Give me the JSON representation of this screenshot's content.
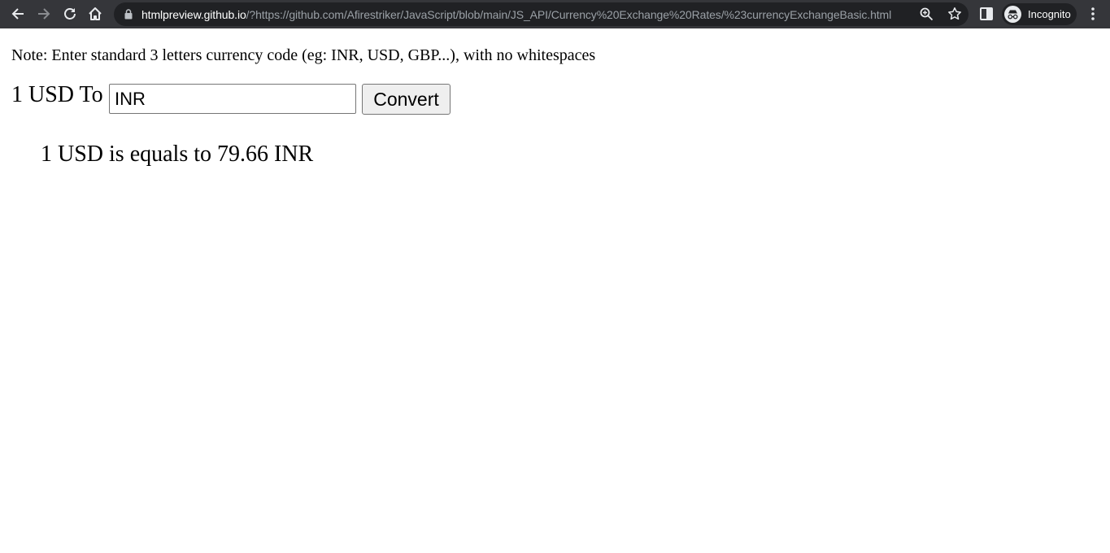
{
  "browser": {
    "url_host": "htmlpreview.github.io",
    "url_rest": "/?https://github.com/Afirestriker/JavaScript/blob/main/JS_API/Currency%20Exchange%20Rates/%23currencyExchangeBasic.html",
    "profile_label": "Incognito",
    "icons": {
      "back": "back-arrow-icon",
      "forward": "forward-arrow-icon",
      "reload": "reload-icon",
      "home": "home-icon",
      "lock": "lock-icon",
      "zoom": "zoom-icon",
      "bookmark": "star-icon",
      "side_panel": "side-panel-icon",
      "incognito": "incognito-icon",
      "menu": "kebab-menu-icon"
    },
    "colors": {
      "toolbar": "#35363a",
      "omnibox": "#202124"
    }
  },
  "page": {
    "note": "Note: Enter standard 3 letters currency code (eg: INR, USD, GBP...), with no whitespaces",
    "prefix": "1 USD To",
    "currency_input_value": "INR",
    "convert_label": "Convert",
    "result": "1 USD is equals to 79.66 INR"
  }
}
